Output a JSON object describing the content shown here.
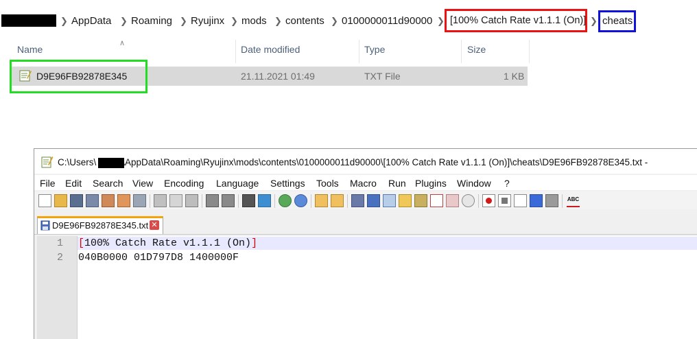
{
  "explorer": {
    "breadcrumb": [
      "AppData",
      "Roaming",
      "Ryujinx",
      "mods",
      "contents",
      "0100000011d90000",
      "[100% Catch Rate v1.1.1 (On)]",
      "cheats"
    ],
    "columns": {
      "name": "Name",
      "date": "Date modified",
      "type": "Type",
      "size": "Size"
    },
    "file": {
      "name": "D9E96FB92878E345",
      "date": "21.11.2021 01:49",
      "type": "TXT File",
      "size": "1 KB"
    }
  },
  "notepad": {
    "title_prefix": "C:\\Users\\",
    "title_suffix": "\\AppData\\Roaming\\Ryujinx\\mods\\contents\\0100000011d90000\\[100% Catch Rate v1.1.1 (On)]\\cheats\\D9E96FB92878E345.txt -",
    "menus": [
      "File",
      "Edit",
      "Search",
      "View",
      "Encoding",
      "Language",
      "Settings",
      "Tools",
      "Macro",
      "Run",
      "Plugins",
      "Window",
      "?"
    ],
    "tab_label": "D9E96FB92878E345.txt",
    "tab_close": "✕",
    "line_numbers": [
      "1",
      "2"
    ],
    "lines": {
      "l1_open": "[",
      "l1_text": "100% Catch Rate v1.1.1 (On)",
      "l1_close": "]",
      "l2": "040B0000 01D797D8 1400000F"
    },
    "toolbar_last_label": "ABC"
  },
  "colors": {
    "highlight_red": "#ee1111",
    "highlight_blue": "#1111dd",
    "highlight_green": "#22dd22",
    "tab_accent": "#f5a30a"
  }
}
